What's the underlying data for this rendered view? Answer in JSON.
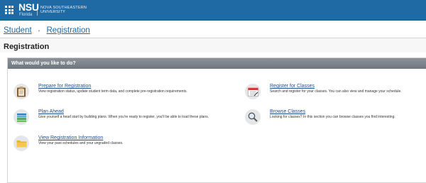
{
  "header": {
    "logo_main": "NSU",
    "logo_sub": "Florida",
    "university_line1": "NOVA SOUTHEASTERN",
    "university_line2": "UNIVERSITY",
    "brand_color": "#1f6aa5"
  },
  "breadcrumb": {
    "items": [
      "Student",
      "Registration"
    ],
    "separator": "•"
  },
  "page": {
    "title": "Registration"
  },
  "panel": {
    "heading": "What would you like to do?"
  },
  "actions": [
    {
      "title": "Prepare for Registration",
      "description": "View registration status, update student term data, and complete pre-registration requirements.",
      "icon": "clipboard-icon"
    },
    {
      "title": "Register for Classes",
      "description": "Search and register for your classes. You can also view and manage your schedule.",
      "icon": "calendar-icon"
    },
    {
      "title": "Plan Ahead",
      "description": "Give yourself a head start by building plans. When you're ready to register, you'll be able to load these plans.",
      "icon": "plan-list-icon"
    },
    {
      "title": "Browse Classes",
      "description": "Looking for classes? In this section you can browse classes you find interesting.",
      "icon": "magnifier-icon"
    },
    {
      "title": "View Registration Information",
      "description": "View your past schedules and your ungraded classes.",
      "icon": "folder-icon"
    }
  ]
}
